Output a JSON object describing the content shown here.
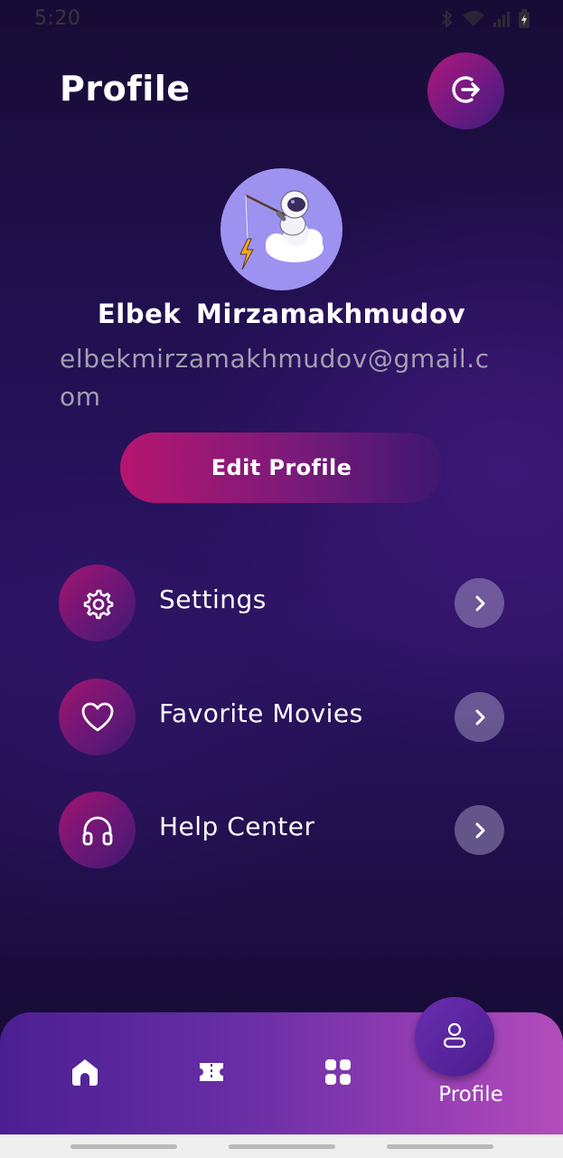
{
  "status_bar": {
    "time": "5:20",
    "icons": [
      "bluetooth-icon",
      "wifi-icon",
      "signal-icon",
      "battery-charging-icon"
    ]
  },
  "header": {
    "title": "Profile",
    "logout_icon": "logout-icon"
  },
  "profile": {
    "avatar": "astronaut-avatar",
    "name": "Elbek  Mirzamakhmudov",
    "email": "elbekmirzamakhmudov@gmail.com",
    "edit_label": "Edit Profile"
  },
  "menu": {
    "items": [
      {
        "label": "Settings",
        "icon": "gear-icon"
      },
      {
        "label": "Favorite Movies",
        "icon": "heart-icon"
      },
      {
        "label": "Help Center",
        "icon": "headphones-icon"
      }
    ]
  },
  "bottom_nav": {
    "items": [
      {
        "icon": "home-icon"
      },
      {
        "icon": "ticket-icon"
      },
      {
        "icon": "grid-icon"
      },
      {
        "icon": "user-icon",
        "label": "Profile"
      }
    ],
    "active_label": "Profile"
  },
  "colors": {
    "accent_pink": "#b5166f",
    "accent_purple": "#4a1f92",
    "background": "#221052"
  }
}
